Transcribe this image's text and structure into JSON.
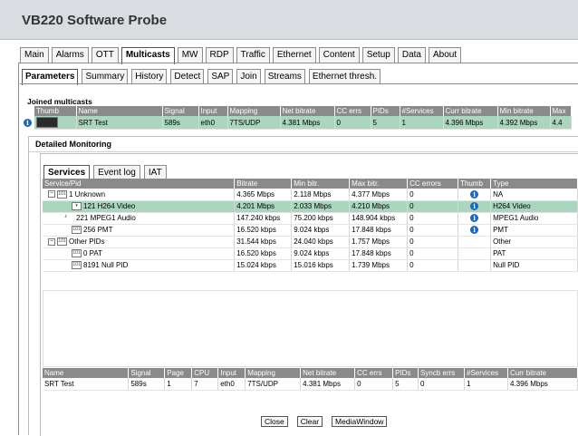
{
  "app": {
    "title": "VB220 Software Probe"
  },
  "main_tabs": [
    "Main",
    "Alarms",
    "OTT",
    "Multicasts",
    "MW",
    "RDP",
    "Traffic",
    "Ethernet",
    "Content",
    "Setup",
    "Data",
    "About"
  ],
  "sub_tabs": [
    "Parameters",
    "Summary",
    "History",
    "Detect",
    "SAP",
    "Join",
    "Streams",
    "Ethernet thresh."
  ],
  "joined": {
    "label": "Joined multicasts",
    "headers": [
      "Thumb",
      "Name",
      "Signal",
      "Input",
      "Mapping",
      "Net bitrate",
      "CC errs",
      "PIDs",
      "#Services",
      "Curr bitrate",
      "Min bitrate",
      "Max"
    ],
    "row": [
      "",
      "SRT Test",
      "589s",
      "eth0",
      "7TS/UDP",
      "4.381 Mbps",
      "0",
      "5",
      "1",
      "4.396 Mbps",
      "4.392 Mbps",
      "4.4"
    ]
  },
  "detailed": {
    "title": "Detailed Monitoring"
  },
  "svc_tabs": [
    "Services",
    "Event log",
    "IAT"
  ],
  "services": {
    "headers": [
      "Service/Pid",
      "Bitrate",
      "Min bitr.",
      "Max bitr.",
      "CC errors",
      "Thumb",
      "Type"
    ],
    "rows": [
      {
        "name": "1 Unknown",
        "bitrate": "4.365 Mbps",
        "min": "2.118 Mbps",
        "max": "4.377 Mbps",
        "cc": "0",
        "type": "NA"
      },
      {
        "name": "121 H264 Video",
        "bitrate": "4.201 Mbps",
        "min": "2.033 Mbps",
        "max": "4.210 Mbps",
        "cc": "0",
        "type": "H264 Video"
      },
      {
        "name": "221 MPEG1 Audio",
        "bitrate": "147.240 kbps",
        "min": "75.200 kbps",
        "max": "148.904 kbps",
        "cc": "0",
        "type": "MPEG1 Audio"
      },
      {
        "name": "256 PMT",
        "bitrate": "16.520 kbps",
        "min": "9.024 kbps",
        "max": "17.848 kbps",
        "cc": "0",
        "type": "PMT"
      },
      {
        "name": "Other PIDs",
        "bitrate": "31.544 kbps",
        "min": "24.040 kbps",
        "max": "1.757 Mbps",
        "cc": "0",
        "type": "Other"
      },
      {
        "name": "0 PAT",
        "bitrate": "16.520 kbps",
        "min": "9.024 kbps",
        "max": "17.848 kbps",
        "cc": "0",
        "type": "PAT"
      },
      {
        "name": "8191 Null PID",
        "bitrate": "15.024 kbps",
        "min": "15.016 kbps",
        "max": "1.739 Mbps",
        "cc": "0",
        "type": "Null PID"
      }
    ]
  },
  "bottom": {
    "headers": [
      "Name",
      "Signal",
      "Page",
      "CPU",
      "Input",
      "Mapping",
      "Net bitrate",
      "CC errs",
      "PIDs",
      "Syncb errs",
      "#Services",
      "Curr bitrate"
    ],
    "row": [
      "SRT Test",
      "589s",
      "1",
      "7",
      "eth0",
      "7TS/UDP",
      "4.381 Mbps",
      "0",
      "5",
      "0",
      "1",
      "4.396 Mbps"
    ]
  },
  "buttons": {
    "close": "Close",
    "clear": "Clear",
    "media": "MediaWindow"
  },
  "colors": {
    "selected_row": "#a9d6bd",
    "header_bg": "#8a8a8a",
    "info_icon": "#1e66c0"
  }
}
